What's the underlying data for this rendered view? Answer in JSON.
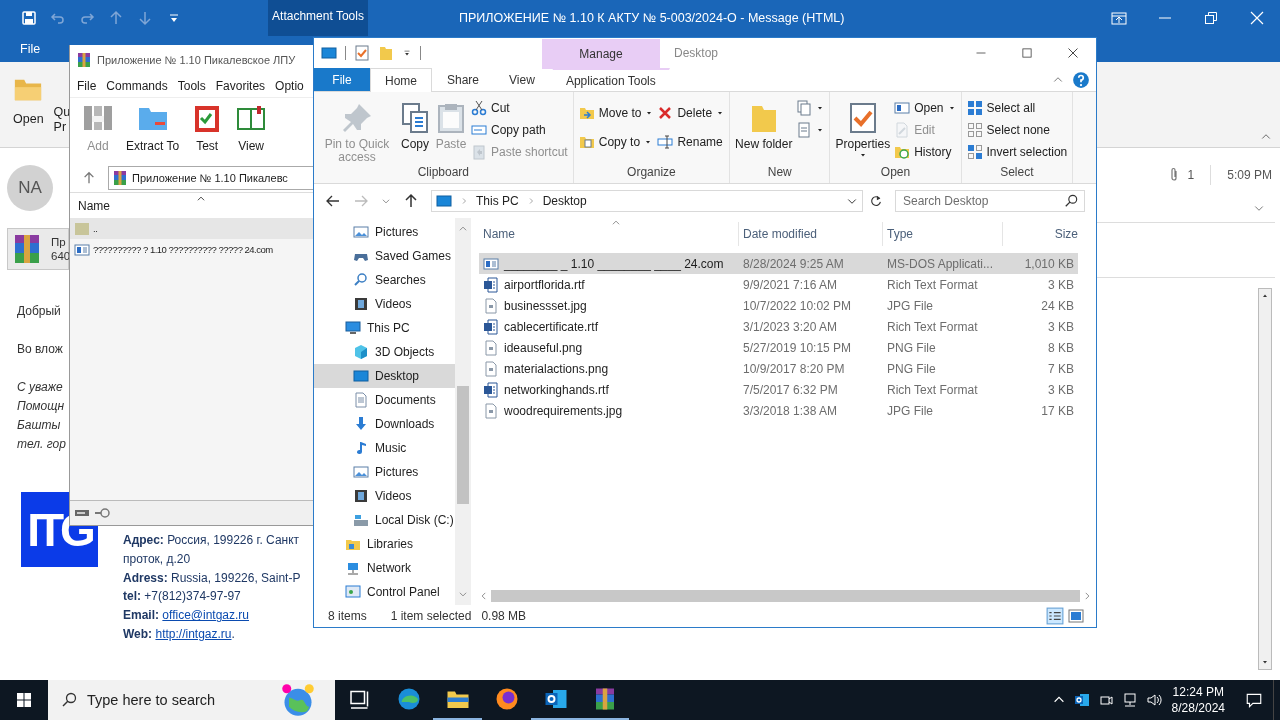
{
  "outlook": {
    "title": "ПРИЛОЖЕНИЕ № 1.10 К АКТУ № 5-003/2024-О  -  Message (HTML)",
    "contextual_tab": "Attachment Tools",
    "tabs": [
      {
        "label": "File",
        "selected": false
      }
    ],
    "ribbon": [
      {
        "lines": [
          "Open"
        ],
        "kind": "open"
      },
      {
        "lines": [
          "Qu",
          "Pr"
        ]
      }
    ],
    "sender_initials": "NA",
    "attachment": {
      "name": "Пр",
      "size": "640"
    },
    "attachment_count": "1",
    "time": "5:09 PM",
    "body": [
      {
        "lines": [
          {
            "text": "Добрый",
            "italic": false
          }
        ]
      },
      {
        "lines": [
          {
            "text": "Во влож",
            "italic": false
          }
        ]
      },
      {
        "lines": [
          {
            "text": "С уваже",
            "italic": true
          },
          {
            "text": "Помощн",
            "italic": true
          },
          {
            "text": "Башты",
            "italic": true
          },
          {
            "text": "тел. гор",
            "italic": true
          }
        ]
      }
    ],
    "logo": "ITG",
    "signature": [
      {
        "text": "**Адрес:** Россия, 199226 г. Санкт"
      },
      {
        "text": "проток, д.20"
      },
      {
        "text": "**Adress:** Russia, 199226,  Saint-P"
      },
      {
        "text": "**tel:** +7(812)374-97-97"
      },
      {
        "text": "**Email:** ",
        "link": "office@intgaz.ru"
      },
      {
        "text": "**Web:** ",
        "link": "http://intgaz.ru",
        "after": "."
      }
    ]
  },
  "winrar": {
    "title": "Приложение № 1.10 Пикалевское ЛПУ",
    "menu": [
      "File",
      "Commands",
      "Tools",
      "Favorites",
      "Optio"
    ],
    "toolbar": [
      {
        "label": "Add",
        "kind": "add",
        "disabled": true
      },
      {
        "label": "Extract To",
        "kind": "extract",
        "disabled": false
      },
      {
        "label": "Test",
        "kind": "test",
        "disabled": false
      },
      {
        "label": "View",
        "kind": "view",
        "disabled": false
      }
    ],
    "path": "Приложение № 1.10 Пикалевс",
    "columns": [
      "Name"
    ],
    "rows": [
      {
        "name": "..",
        "kind": "folder",
        "selected": true
      },
      {
        "name": "?????????? ? 1.10 ?????????? ????? 24.com",
        "kind": "exe",
        "selected": false
      }
    ]
  },
  "explorer": {
    "contextual_label": "Manage",
    "title": "Desktop",
    "tabs": [
      {
        "label": "File",
        "kind": "file",
        "selected": false
      },
      {
        "label": "Home",
        "kind": "normal",
        "selected": true
      },
      {
        "label": "Share",
        "kind": "normal",
        "selected": false
      },
      {
        "label": "View",
        "kind": "normal",
        "selected": false
      },
      {
        "label": "Application Tools",
        "kind": "contextual",
        "selected": false
      }
    ],
    "ribbon": [
      {
        "label": "Clipboard",
        "columns": [
          {
            "kind": "large",
            "items": [
              {
                "label": "Pin to Quick access",
                "kind": "pin",
                "disabled": true,
                "dropdown": false
              }
            ]
          },
          {
            "kind": "large",
            "items": [
              {
                "label": "Copy",
                "kind": "copy",
                "disabled": false,
                "dropdown": false
              }
            ]
          },
          {
            "kind": "large",
            "items": [
              {
                "label": "Paste",
                "kind": "paste",
                "disabled": true,
                "dropdown": false
              }
            ]
          },
          {
            "kind": "stack",
            "items": [
              {
                "label": "Cut",
                "kind": "cut",
                "disabled": false,
                "dropdown": false
              },
              {
                "label": "Copy path",
                "kind": "copypath",
                "disabled": false,
                "dropdown": false
              },
              {
                "label": "Paste shortcut",
                "kind": "pasteshortcut",
                "disabled": true,
                "dropdown": false
              }
            ]
          }
        ]
      },
      {
        "label": "Organize",
        "columns": [
          {
            "kind": "stack",
            "items": [
              {
                "label": "Move to",
                "kind": "moveto",
                "disabled": false,
                "dropdown": true
              },
              {
                "label": "Copy to",
                "kind": "copyto",
                "disabled": false,
                "dropdown": true
              }
            ]
          },
          {
            "kind": "stack",
            "items": [
              {
                "label": "Delete",
                "kind": "delete",
                "disabled": false,
                "dropdown": true
              },
              {
                "label": "Rename",
                "kind": "rename",
                "disabled": false,
                "dropdown": false
              }
            ]
          }
        ]
      },
      {
        "label": "New",
        "columns": [
          {
            "kind": "large",
            "items": [
              {
                "label": "New folder",
                "kind": "newfolder",
                "disabled": false,
                "dropdown": false
              }
            ]
          },
          {
            "kind": "stack",
            "items": [
              {
                "kind": "newitem",
                "disabled": false,
                "dropdown": true
              },
              {
                "kind": "easyaccess",
                "disabled": false,
                "dropdown": true
              }
            ]
          }
        ]
      },
      {
        "label": "Open",
        "columns": [
          {
            "kind": "large",
            "items": [
              {
                "label": "Properties",
                "kind": "properties",
                "disabled": false,
                "dropdown": true
              }
            ]
          },
          {
            "kind": "stack",
            "items": [
              {
                "label": "Open",
                "kind": "open",
                "disabled": false,
                "dropdown": true
              },
              {
                "label": "Edit",
                "kind": "edit",
                "disabled": true,
                "dropdown": false
              },
              {
                "label": "History",
                "kind": "history",
                "disabled": false,
                "dropdown": false
              }
            ]
          }
        ]
      },
      {
        "label": "Select",
        "columns": [
          {
            "kind": "stack",
            "items": [
              {
                "label": "Select all",
                "kind": "selectall",
                "disabled": false,
                "dropdown": false
              },
              {
                "label": "Select none",
                "kind": "selectnone",
                "disabled": false,
                "dropdown": false
              },
              {
                "label": "Invert selection",
                "kind": "invert",
                "disabled": false,
                "dropdown": false
              }
            ]
          }
        ]
      }
    ],
    "breadcrumb": [
      "This PC",
      "Desktop"
    ],
    "search": {
      "placeholder": "Search Desktop"
    },
    "navigation": {
      "continued_children": [
        {
          "label": "Pictures",
          "kind": "pictures",
          "selected": false
        },
        {
          "label": "Saved Games",
          "kind": "games",
          "selected": false
        },
        {
          "label": "Searches",
          "kind": "search",
          "selected": false
        },
        {
          "label": "Videos",
          "kind": "videos",
          "selected": false
        }
      ],
      "items": [
        {
          "label": "This PC",
          "kind": "pc",
          "selected": false,
          "children": [
            {
              "label": "3D Objects",
              "kind": "cube",
              "selected": false
            },
            {
              "label": "Desktop",
              "kind": "desktop",
              "selected": true
            },
            {
              "label": "Documents",
              "kind": "documents",
              "selected": false
            },
            {
              "label": "Downloads",
              "kind": "downloads",
              "selected": false
            },
            {
              "label": "Music",
              "kind": "music",
              "selected": false
            },
            {
              "label": "Pictures",
              "kind": "pictures",
              "selected": false
            },
            {
              "label": "Videos",
              "kind": "videos",
              "selected": false
            },
            {
              "label": "Local Disk (C:)",
              "kind": "disk",
              "selected": false
            }
          ]
        },
        {
          "label": "Libraries",
          "kind": "libraries",
          "selected": false
        },
        {
          "label": "Network",
          "kind": "network",
          "selected": false
        },
        {
          "label": "Control Panel",
          "kind": "control",
          "selected": false
        }
      ]
    },
    "columns": [
      "Name",
      "Date modified",
      "Type",
      "Size"
    ],
    "files": [
      {
        "name": "________ _ 1.10 ________ ____ 24.com",
        "date": "8/28/2024 9:25 AM",
        "type": "MS-DOS Applicati...",
        "size": "1,010 KB",
        "kind": "exe",
        "selected": true
      },
      {
        "name": "airportflorida.rtf",
        "date": "9/9/2021 7:16 AM",
        "type": "Rich Text Format",
        "size": "3 KB",
        "kind": "rtf",
        "selected": false
      },
      {
        "name": "businessset.jpg",
        "date": "10/7/2022 10:02 PM",
        "type": "JPG File",
        "size": "24 KB",
        "kind": "image",
        "selected": false
      },
      {
        "name": "cablecertificate.rtf",
        "date": "3/1/2023 3:20 AM",
        "type": "Rich Text Format",
        "size": "3 KB",
        "kind": "rtf",
        "selected": false
      },
      {
        "name": "ideauseful.png",
        "date": "5/27/2019 10:15 PM",
        "type": "PNG File",
        "size": "8 KB",
        "kind": "image",
        "selected": false
      },
      {
        "name": "materialactions.png",
        "date": "10/9/2017 8:20 PM",
        "type": "PNG File",
        "size": "7 KB",
        "kind": "image",
        "selected": false
      },
      {
        "name": "networkinghands.rtf",
        "date": "7/5/2017 6:32 PM",
        "type": "Rich Text Format",
        "size": "3 KB",
        "kind": "rtf",
        "selected": false
      },
      {
        "name": "woodrequirements.jpg",
        "date": "3/3/2018 1:38 AM",
        "type": "JPG File",
        "size": "17 KB",
        "kind": "image",
        "selected": false
      }
    ],
    "status": {
      "count": "8 items",
      "selection": "1 item selected",
      "size": "0.98 MB"
    }
  },
  "taskbar": {
    "search": {
      "placeholder": "Type here to search"
    },
    "apps": [
      {
        "kind": "taskview",
        "running": false
      },
      {
        "kind": "edge",
        "running": false
      },
      {
        "kind": "explorerapp",
        "running": true
      },
      {
        "kind": "firefox",
        "running": false
      },
      {
        "kind": "outlookapp",
        "running": true
      },
      {
        "kind": "winrar",
        "running": true
      }
    ],
    "time": "12:24 PM",
    "date": "8/28/2024"
  }
}
